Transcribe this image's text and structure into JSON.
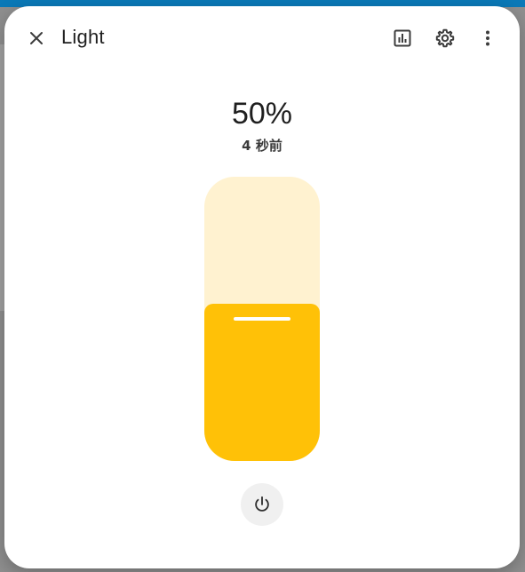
{
  "dialog": {
    "title": "Light"
  },
  "state": {
    "value": "50%",
    "last_changed": "4 秒前",
    "brightness_percent": 50
  },
  "icons": {
    "close": "close-icon",
    "history": "chart-box-icon",
    "settings": "cog-icon",
    "more": "dots-vertical-icon",
    "power": "power-icon"
  },
  "colors": {
    "fill": "#ffc107",
    "track": "#fff2d0",
    "header": "#0a79b8"
  }
}
